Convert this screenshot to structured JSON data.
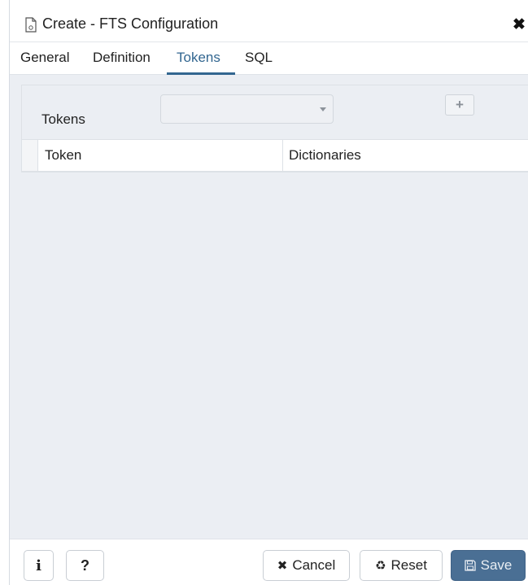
{
  "dialog": {
    "title": "Create - FTS Configuration",
    "title_icon": "document-icon",
    "close_label": "✖"
  },
  "tabs": [
    {
      "label": "General",
      "active": false
    },
    {
      "label": "Definition",
      "active": false
    },
    {
      "label": "Tokens",
      "active": true
    },
    {
      "label": "SQL",
      "active": false
    }
  ],
  "tokens": {
    "label": "Tokens",
    "select_value": "",
    "add_label": "+",
    "columns": [
      "Token",
      "Dictionaries"
    ],
    "rows": []
  },
  "footer": {
    "info_label": "i",
    "help_label": "?",
    "cancel_icon": "✖",
    "cancel_label": "Cancel",
    "reset_icon": "♻",
    "reset_label": "Reset",
    "save_icon": "🖫",
    "save_label": "Save"
  },
  "colors": {
    "accent": "#326690",
    "save_button": "#4a6f94",
    "content_bg": "#ebeef3"
  }
}
